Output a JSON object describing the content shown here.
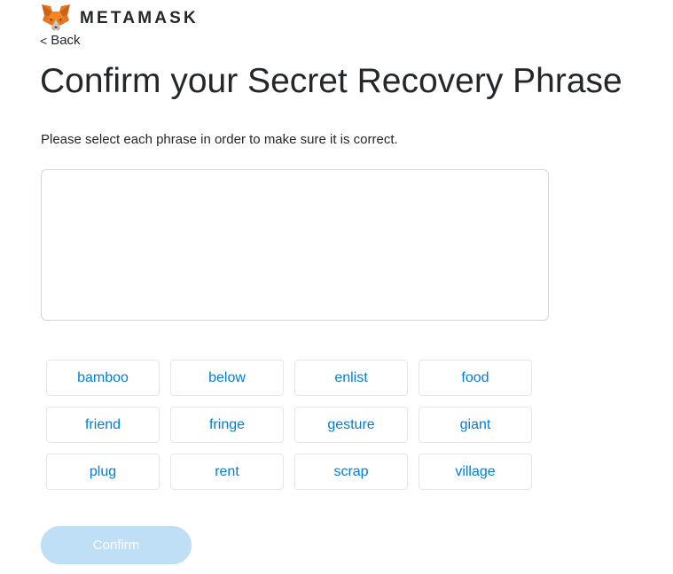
{
  "header": {
    "brand_name": "METAMASK",
    "logo_icon": "fox-icon",
    "back_label": "Back"
  },
  "page": {
    "title": "Confirm your Secret Recovery Phrase",
    "instruction": "Please select each phrase in order to make sure it is correct."
  },
  "selected_phrase": [],
  "word_options": [
    "bamboo",
    "below",
    "enlist",
    "food",
    "friend",
    "fringe",
    "gesture",
    "giant",
    "plug",
    "rent",
    "scrap",
    "village"
  ],
  "actions": {
    "confirm_label": "Confirm",
    "confirm_disabled": true
  },
  "colors": {
    "accent": "#037dd6",
    "disabled_button": "#bfdff6",
    "text": "#24272a",
    "border": "#d2d8dd"
  }
}
